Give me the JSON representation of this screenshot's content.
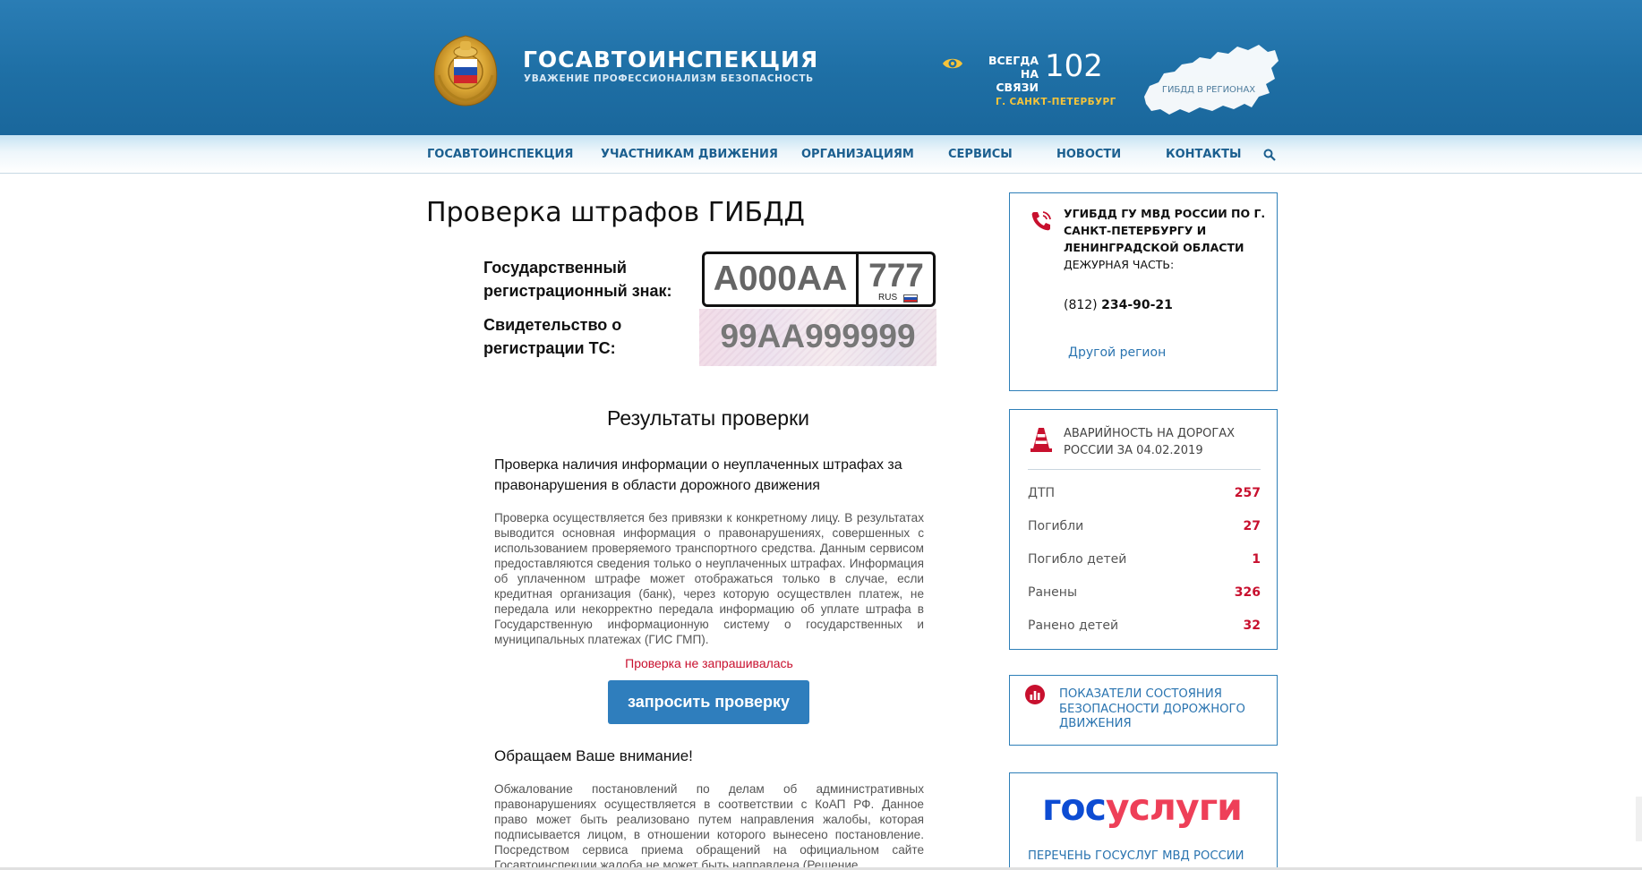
{
  "header": {
    "brand_title": "ГОСАВТОИНСПЕКЦИЯ",
    "brand_subtitle": "УВАЖЕНИЕ ПРОФЕССИОНАЛИЗМ БЕЗОПАСНОСТЬ",
    "always_line1": "ВСЕГДА",
    "always_line2": "НА СВЯЗИ",
    "hotline": "102",
    "city": "Г. САНКТ-ПЕТЕРБУРГ",
    "map_label": "ГИБДД В РЕГИОНАХ",
    "icons": [
      "emblem-logo",
      "eye-icon",
      "russia-map-icon"
    ]
  },
  "nav": {
    "items": [
      {
        "label": "ГОСАВТОИНСПЕКЦИЯ"
      },
      {
        "label": "УЧАСТНИКАМ ДВИЖЕНИЯ"
      },
      {
        "label": "ОРГАНИЗАЦИЯМ"
      },
      {
        "label": "СЕРВИСЫ"
      },
      {
        "label": "НОВОСТИ"
      },
      {
        "label": "КОНТАКТЫ"
      }
    ],
    "search_icon": "search-icon"
  },
  "main": {
    "title": "Проверка штрафов ГИБДД",
    "plate_label_line1": "Государственный",
    "plate_label_line2": "регистрационный знак:",
    "plate_number": "А000АА",
    "plate_region": "777",
    "plate_country": "RUS",
    "cert_label_line1": "Свидетельство о",
    "cert_label_line2": "регистрации ТС:",
    "cert_number": "99АА999999",
    "results_title": "Результаты проверки",
    "check_heading": "Проверка наличия информации о неуплаченных штрафах за правонарушения в области дорожного движения",
    "check_description": "Проверка осуществляется без привязки к конкретному лицу. В результатах выводится основная информация о правонарушениях, совершенных с использованием проверяемого транспортного средства. Данным сервисом предоставляются сведения только о неуплаченных штрафах. Информация об уплаченном штрафе может отображаться только в случае, если кредитная организация (банк), через которую осуществлен платеж, не передала или некорректно передала информацию об уплате штрафа в Государственную информационную систему о государственных и муниципальных платежах (ГИС ГМП).",
    "status": "Проверка не запрашивалась",
    "request_button": "запросить проверку",
    "attention_title": "Обращаем Ваше внимание!",
    "attention_text": "Обжалование постановлений по делам об административных правонарушениях осуществляется в соответствии с КоАП РФ. Данное право может быть реализовано путем направления жалобы, которая подписывается лицом, в отношении которого вынесено постановление. Посредством сервиса приема обращений на официальном сайте Госавтоинспекции жалоба не может быть направлена (Решение"
  },
  "sidebar": {
    "contact": {
      "org_name": "УГИБДД ГУ МВД РОССИИ ПО Г. САНКТ-ПЕТЕРБУРГУ И ЛЕНИНГРАДСКОЙ ОБЛАСТИ",
      "duty_label": "ДЕЖУРНАЯ ЧАСТЬ:",
      "phone_code": "(812)",
      "phone_number": "234-90-21",
      "other_region": "Другой регион",
      "icon": "phone-icon"
    },
    "accidents": {
      "title": "АВАРИЙНОСТЬ НА ДОРОГАХ РОССИИ ЗА 04.02.2019",
      "icon": "traffic-cone-icon",
      "stats": [
        {
          "label": "ДТП",
          "value": "257"
        },
        {
          "label": "Погибли",
          "value": "27"
        },
        {
          "label": "Погибло детей",
          "value": "1"
        },
        {
          "label": "Ранены",
          "value": "326"
        },
        {
          "label": "Ранено детей",
          "value": "32"
        }
      ]
    },
    "indicators": {
      "label": "ПОКАЗАТЕЛИ СОСТОЯНИЯ БЕЗОПАСНОСТИ ДОРОЖНОГО ДВИЖЕНИЯ",
      "icon": "chart-icon"
    },
    "gosuslugi": {
      "logo_part1": "гос",
      "logo_part2": "услуги",
      "list_link": "ПЕРЕЧЕНЬ ГОСУСЛУГ МВД РОССИИ"
    }
  },
  "colors": {
    "header_blue": "#1e6fa5",
    "nav_text": "#1b5f8f",
    "accent_red": "#c8102e",
    "button_blue": "#2f7ebd",
    "link_blue": "#2a74b0",
    "city_gold": "#f6c43a"
  }
}
